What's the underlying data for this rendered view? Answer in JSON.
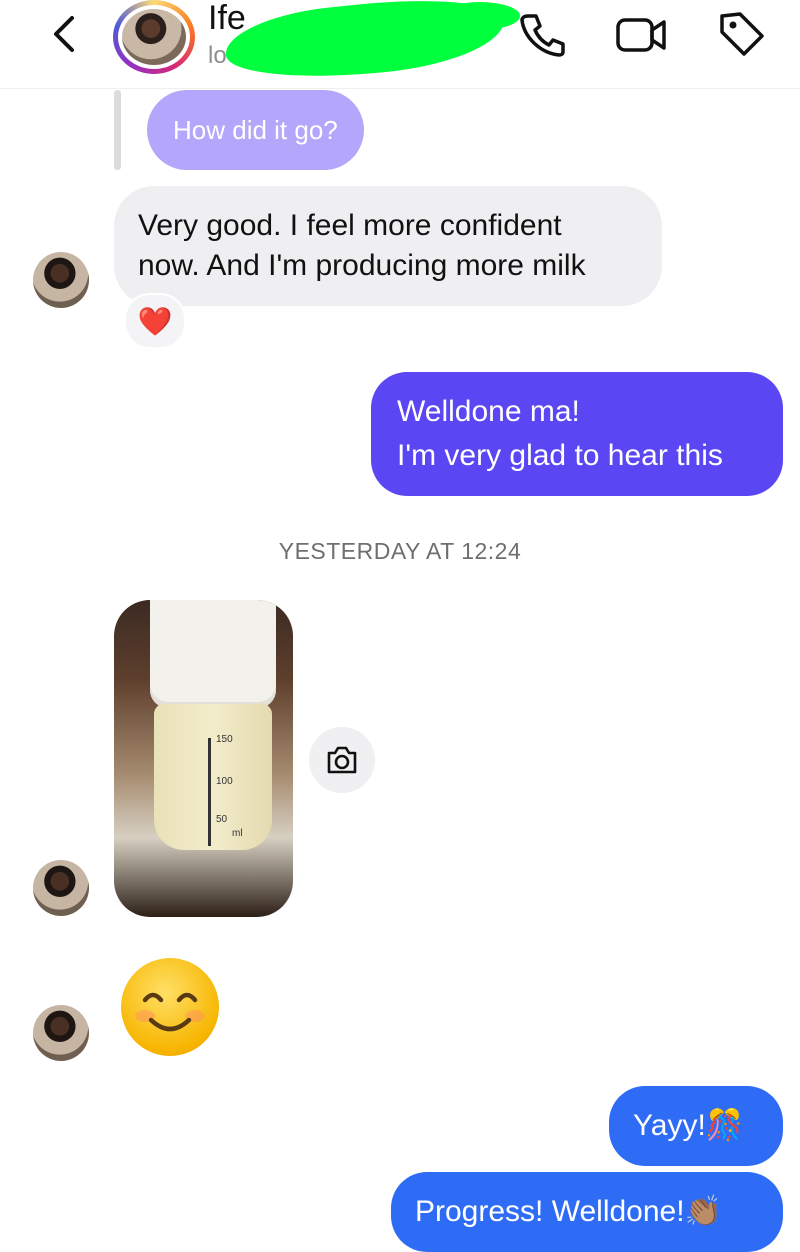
{
  "header": {
    "contact_name_visible": "Ife",
    "contact_sub_visible": "lo",
    "icons": [
      "back-icon",
      "phone-icon",
      "video-icon",
      "tag-icon"
    ]
  },
  "thread": {
    "quoted_message": "How did it go?",
    "incoming_1": [
      "Very good. I feel more confident",
      "now. And I'm producing more milk"
    ],
    "reaction": "❤️",
    "outgoing_1": [
      "Welldone ma!",
      "I'm very glad to hear this"
    ],
    "timestamp": "YESTERDAY AT 12:24",
    "photo_labels": {
      "mark_150": "150",
      "mark_100": "100",
      "mark_50": "50",
      "unit": "ml"
    },
    "emoji_message": "😊",
    "outgoing_2": "Yayy!🎊",
    "outgoing_3": "Progress! Welldone!👏🏽"
  },
  "colors": {
    "quote_bubble": "#b4a7fb",
    "incoming_bubble": "#efeff2",
    "outgoing_purple": "#5b46f4",
    "outgoing_blue": "#2f6cf6",
    "redaction": "#00ff3c"
  }
}
